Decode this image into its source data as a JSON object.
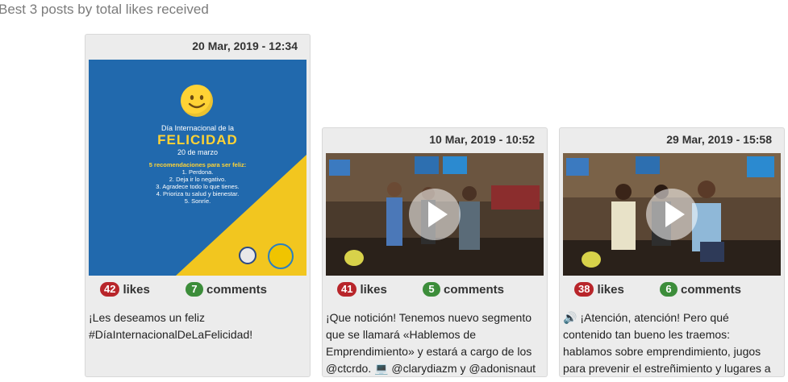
{
  "section": {
    "title": "Best 3 posts by total likes received"
  },
  "colors": {
    "likes_badge": "#b8252a",
    "comments_badge": "#3c8d3a",
    "card_bg": "#ececec"
  },
  "posts": [
    {
      "date": "20 Mar, 2019 - 12:34",
      "media_type": "image",
      "image_text": {
        "l1": "Día Internacional de la",
        "l2": "FELICIDAD",
        "l3": "20 de marzo",
        "l4": "5 recomendaciones para ser feliz:",
        "items": [
          "1. Perdona.",
          "2. Deja ir lo negativo.",
          "3. Agradece todo lo que tienes.",
          "4. Prioriza tu salud y bienestar.",
          "5. Sonríe."
        ]
      },
      "likes": "42",
      "likes_label": "likes",
      "comments": "7",
      "comments_label": "comments",
      "caption": "¡Les deseamos un feliz #DíaInternacionalDeLaFelicidad!"
    },
    {
      "date": "10 Mar, 2019 - 10:52",
      "media_type": "video",
      "likes": "41",
      "likes_label": "likes",
      "comments": "5",
      "comments_label": "comments",
      "caption": "¡Que notición! Tenemos nuevo segmento que se llamará «Hablemos de Emprendimiento» y estará a cargo de los @ctcrdo. 💻 @clarydiazm y @adonisnaut"
    },
    {
      "date": "29 Mar, 2019 - 15:58",
      "media_type": "video",
      "likes": "38",
      "likes_label": "likes",
      "comments": "6",
      "comments_label": "comments",
      "caption": "🔊 ¡Atención, atención! Pero qué contenido tan bueno les traemos: hablamos sobre emprendimiento, jugos para prevenir el estreñimiento y lugares a"
    }
  ]
}
